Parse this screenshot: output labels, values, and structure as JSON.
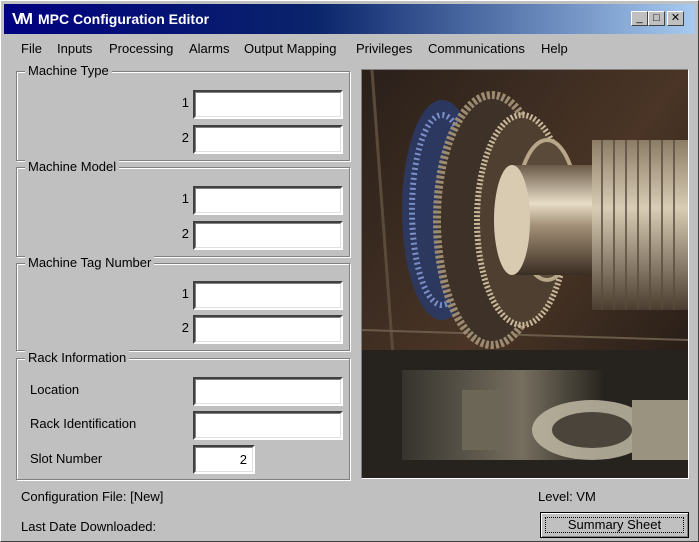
{
  "title_bar": {
    "logo": "VM",
    "title": "MPC Configuration Editor",
    "minimize": "_",
    "maximize": "□",
    "close": "✕"
  },
  "menu": [
    "File",
    "Inputs",
    "Processing",
    "Alarms",
    "Output Mapping",
    "Privileges",
    "Communications",
    "Help"
  ],
  "machine_type": {
    "legend": "Machine Type",
    "rows": [
      {
        "num": "1",
        "value": ""
      },
      {
        "num": "2",
        "value": ""
      }
    ]
  },
  "machine_model": {
    "legend": "Machine Model",
    "rows": [
      {
        "num": "1",
        "value": ""
      },
      {
        "num": "2",
        "value": ""
      }
    ]
  },
  "machine_tag": {
    "legend": "Machine Tag Number",
    "rows": [
      {
        "num": "1",
        "value": ""
      },
      {
        "num": "2",
        "value": ""
      }
    ]
  },
  "rack": {
    "legend": "Rack Information",
    "location_label": "Location",
    "location_value": "",
    "rack_id_label": "Rack Identification",
    "rack_id_value": "",
    "slot_label": "Slot Number",
    "slot_value": "2"
  },
  "status": {
    "config_file": "Configuration File: [New]",
    "last_download": "Last Date Downloaded:",
    "level": "Level: VM"
  },
  "summary_button": "Summary Sheet"
}
